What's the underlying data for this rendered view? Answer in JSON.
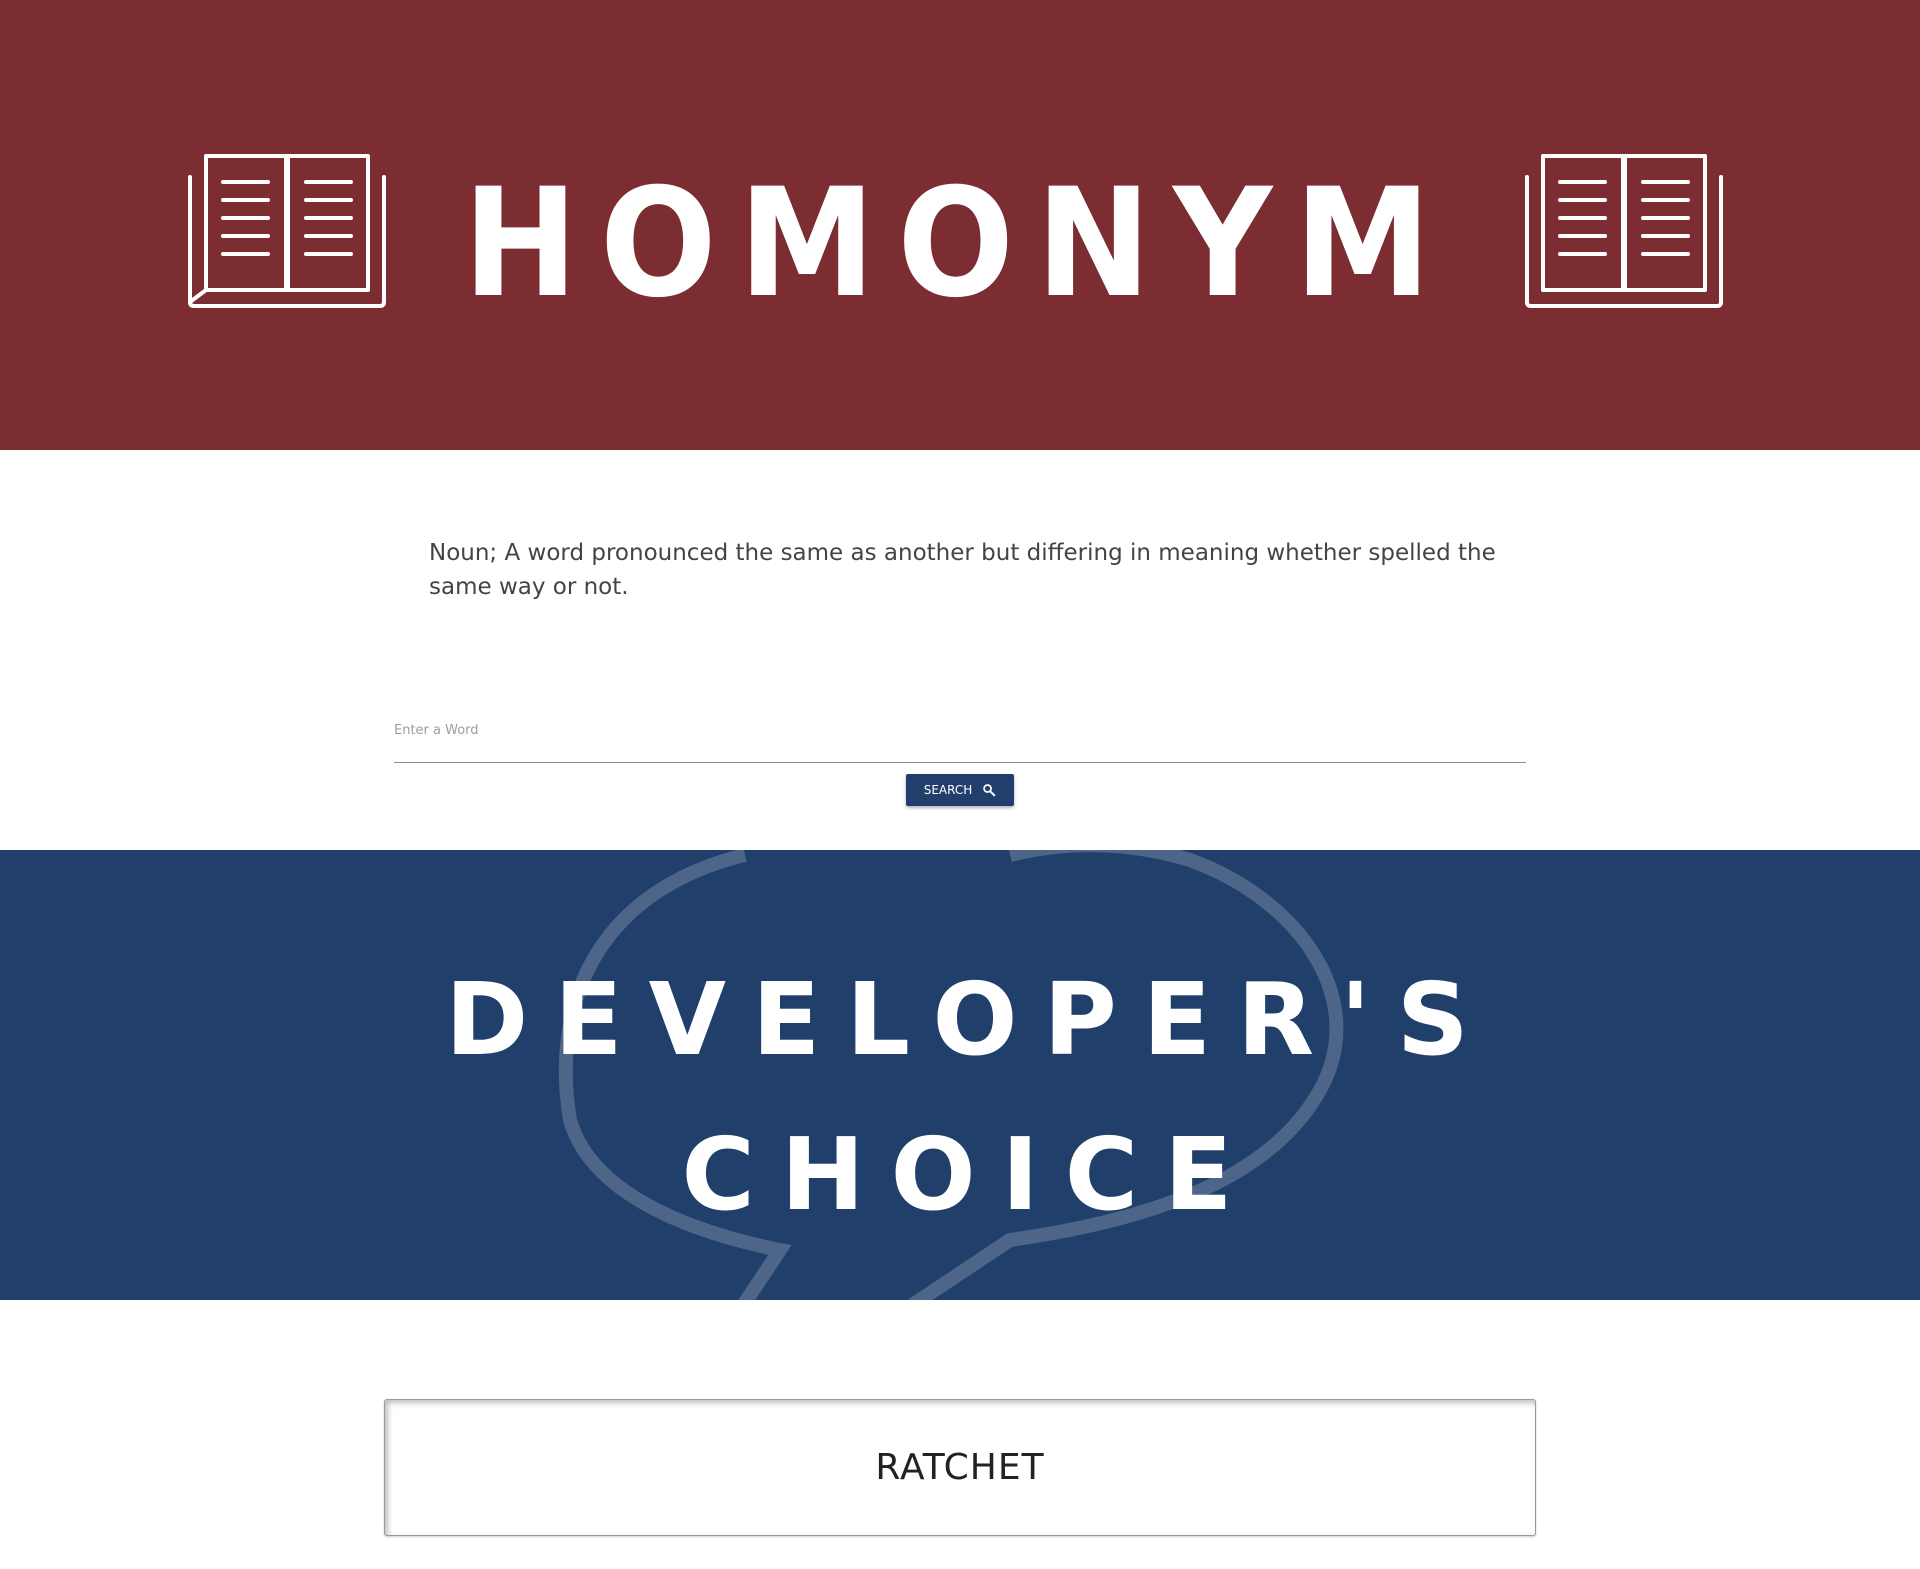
{
  "hero": {
    "logo_text": "HOMONYM",
    "left_icon": "open-book-icon",
    "right_icon": "open-book-icon",
    "background": "#7c2d31"
  },
  "definition": {
    "text": "Noun; A word pronounced the same as another but differing in meaning whether spelled the same way or not."
  },
  "search": {
    "placeholder": "Enter a Word",
    "value": "",
    "button_label": "SEARCH",
    "button_icon": "search-icon",
    "button_color": "#223f6b"
  },
  "developers_choice": {
    "line1": "DEVELOPER'S",
    "line2": "CHOICE",
    "background": "#203f6b",
    "decoration_icon": "speech-bubble-icon"
  },
  "featured_word": {
    "word": "RATCHET"
  }
}
